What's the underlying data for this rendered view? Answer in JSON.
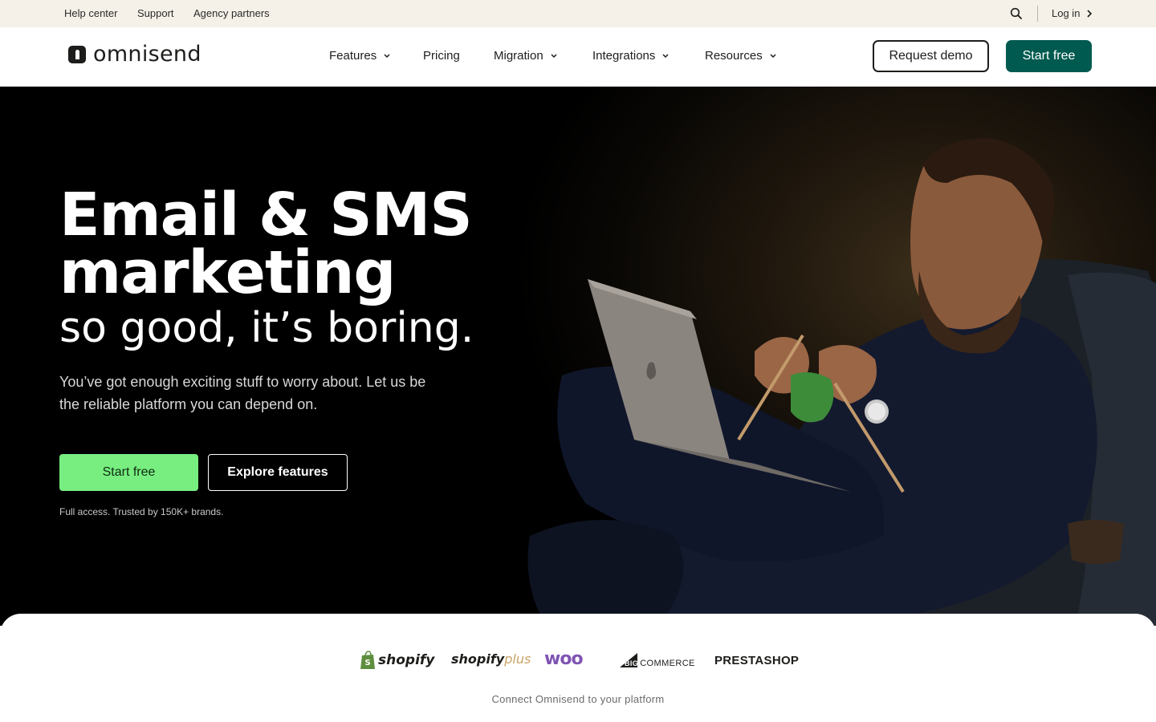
{
  "topbar": {
    "links": [
      "Help center",
      "Support",
      "Agency partners"
    ],
    "login_label": "Log in"
  },
  "nav": {
    "logo_text": "omnisend",
    "items": [
      {
        "label": "Features",
        "has_dropdown": true
      },
      {
        "label": "Pricing",
        "has_dropdown": false
      },
      {
        "label": "Migration",
        "has_dropdown": true
      },
      {
        "label": "Integrations",
        "has_dropdown": true
      },
      {
        "label": "Resources",
        "has_dropdown": true
      }
    ],
    "request_demo_label": "Request demo",
    "start_free_label": "Start free"
  },
  "hero": {
    "title_line1": "Email & SMS",
    "title_line2": "marketing",
    "subtitle": "so good, it’s boring.",
    "description": "You’ve got enough exciting stuff to worry about. Let us be the reliable platform you can depend on.",
    "start_free_label": "Start free",
    "explore_label": "Explore features",
    "note": "Full access. Trusted by 150K+ brands."
  },
  "platforms": {
    "items": [
      {
        "name": "shopify"
      },
      {
        "name_a": "shopify",
        "name_b": "plus"
      },
      {
        "name": "woo"
      },
      {
        "name_a": "BIG",
        "name_b": "COMMERCE"
      },
      {
        "name": "PRESTASHOP"
      }
    ],
    "caption": "Connect Omnisend to your platform"
  },
  "colors": {
    "topbar_bg": "#f5f1e8",
    "brand_green_dark": "#005a4f",
    "cta_green_light": "#78ee80",
    "hero_bg": "#000000",
    "woo_purple": "#7f54b3",
    "shopify_green": "#5e8e3e"
  },
  "icons": [
    "search-icon",
    "chevron-right-icon",
    "chevron-down-icon",
    "omnisend-logo-icon",
    "shopify-bag-icon",
    "bigcommerce-triangle-icon"
  ]
}
